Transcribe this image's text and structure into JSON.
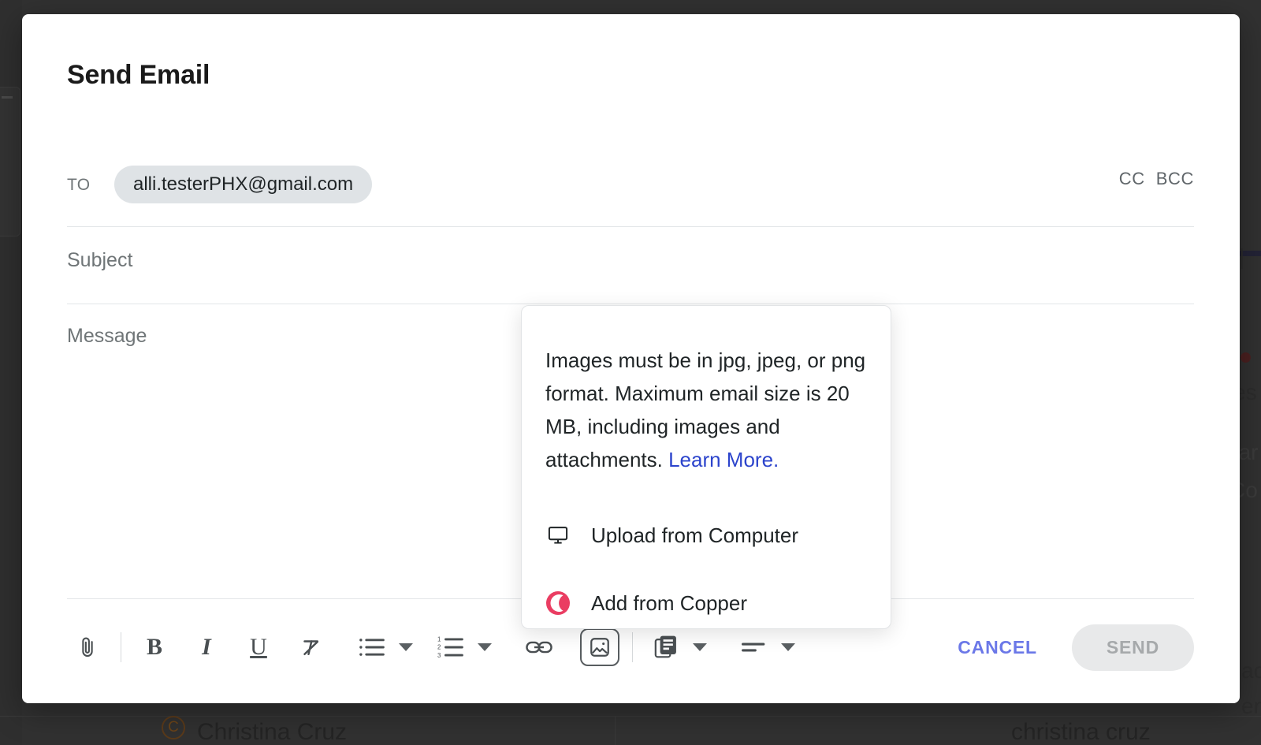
{
  "modal": {
    "title": "Send Email"
  },
  "compose": {
    "to_label": "TO",
    "recipient_chip": "alli.testerPHX@gmail.com",
    "cc_label": "CC",
    "bcc_label": "BCC",
    "subject_placeholder": "Subject",
    "message_placeholder": "Message"
  },
  "popover": {
    "body_text": "Images must be in jpg, jpeg, or png format. Maximum email size is 20 MB, including images and attachments. ",
    "link_text": "Learn More.",
    "items": [
      {
        "label": "Upload from Computer",
        "icon": "monitor-icon"
      },
      {
        "label": "Add from Copper",
        "icon": "copper-logo-icon"
      }
    ]
  },
  "toolbar": {
    "attach_title": "Attach file",
    "bold_label": "B",
    "italic_label": "I",
    "underline_label": "U",
    "clear_format_title": "Clear formatting",
    "bullet_list_title": "Bulleted list",
    "numbered_list_title": "Numbered list",
    "link_title": "Insert link",
    "image_title": "Insert image",
    "template_title": "Templates",
    "signature_title": "Signature",
    "cancel_label": "CANCEL",
    "send_label": "SEND"
  },
  "colors": {
    "link": "#2c44cc",
    "cancel": "#6b78e8",
    "copper_brand": "#ea3d62",
    "chip_bg": "#dfe3e6",
    "send_disabled_bg": "#e8e9ea"
  },
  "background": {
    "contact_name": "Christina Cruz",
    "contact_handle": "christina cruz"
  }
}
